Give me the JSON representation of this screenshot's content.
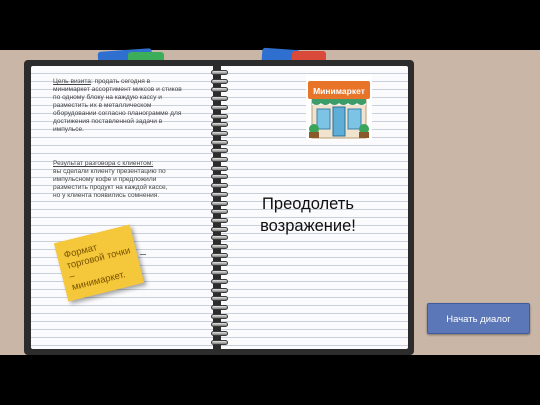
{
  "visit": {
    "goal_heading": "Цель визита",
    "goal_body": ": продать сегодня в\nминимаркет ассортимент миксов и стиков\nпо одному блоку на каждую кассу и\nразместить их в металлическом\nоборудовании согласно планограмме для\nдостижения поставленной задачи в\nимпульсе.",
    "result_heading": "Результат разговора с клиентом:",
    "result_body": "вы сделали клиенту презентацию по\nимпульсному кофе и предложили\nразместить продукт на каждой кассе,\nно у клиента появились сомнения."
  },
  "sticky_note": {
    "text": "Формат\nторговой точки –\nминимаркет."
  },
  "store": {
    "sign": "Минимаркет",
    "icon": "storefront-icon"
  },
  "objective": {
    "text": "Преодолеть\nвозражение!"
  },
  "start_button": {
    "label": "Начать диалог"
  },
  "colors": {
    "button": "#5b77b8",
    "sticky": "#f4c83a",
    "background": "#c9b6a7",
    "store_sign": "#e8742a"
  }
}
